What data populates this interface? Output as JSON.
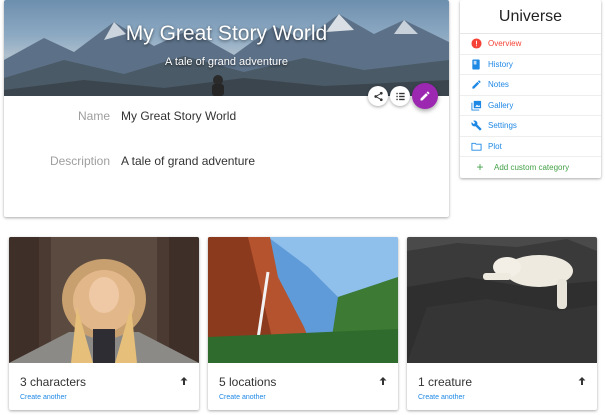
{
  "universe": {
    "title": "My Great Story World",
    "subtitle": "A tale of grand adventure",
    "fields": [
      {
        "label": "Name",
        "value": "My Great Story World"
      },
      {
        "label": "Description",
        "value": "A tale of grand adventure"
      }
    ],
    "icons": {
      "share": "share-icon",
      "list": "list-icon",
      "edit": "pencil-icon"
    },
    "accent_color": "#9c27b0"
  },
  "sidebar": {
    "title": "Universe",
    "items": [
      {
        "label": "Overview",
        "icon": "alert-circle-icon",
        "active": true
      },
      {
        "label": "History",
        "icon": "book-icon"
      },
      {
        "label": "Notes",
        "icon": "pencil-icon"
      },
      {
        "label": "Gallery",
        "icon": "photo-library-icon"
      },
      {
        "label": "Settings",
        "icon": "wrench-icon"
      },
      {
        "label": "Plot",
        "icon": "folder-icon"
      }
    ],
    "add_label": "Add custom category",
    "colors": {
      "link": "#1e88e5",
      "active": "#f44336",
      "add": "#43a047"
    }
  },
  "content_cards": [
    {
      "count": "3 characters",
      "link": "Create another",
      "image": "woman-in-fur-hood-photo"
    },
    {
      "count": "5 locations",
      "link": "Create another",
      "image": "canyon-waterfall-photo"
    },
    {
      "count": "1 creature",
      "link": "Create another",
      "image": "polar-bear-on-rock-photo"
    }
  ]
}
